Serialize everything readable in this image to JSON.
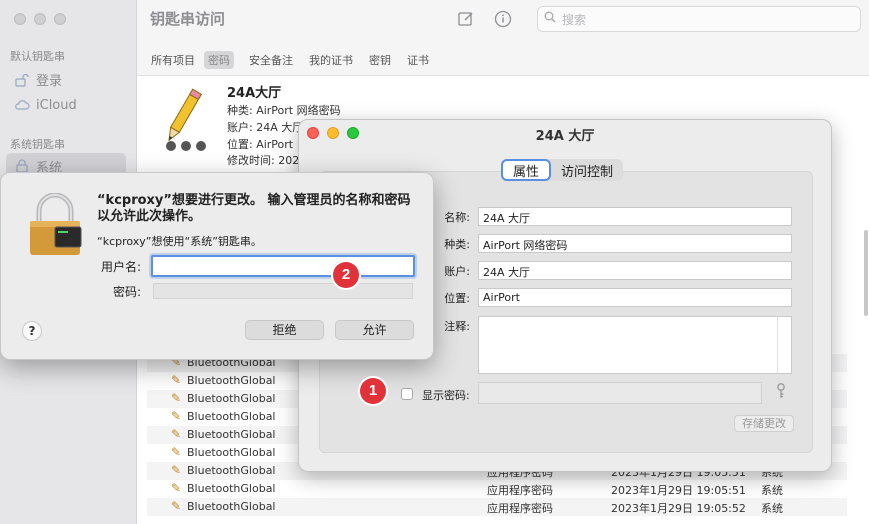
{
  "keychain": {
    "title": "钥匙串访问",
    "search_placeholder": "搜索",
    "sidebar": {
      "default_section": "默认钥匙串",
      "login": "登录",
      "icloud": "iCloud",
      "system_section": "系统钥匙串",
      "system": "系统"
    },
    "category_tabs": [
      "所有项目",
      "密码",
      "安全备注",
      "我的证书",
      "密钥",
      "证书"
    ],
    "active_tab_index": 1,
    "detail": {
      "name": "24A大厅",
      "kind": "种类:  AirPort 网络密码",
      "account": "账户:  24A 大厅",
      "where": "位置:  AirPort",
      "modified": "修改时间:  202"
    },
    "rows": [
      {
        "name": "BluetoothGlobal",
        "kind": "",
        "date": "",
        "keychain": ""
      },
      {
        "name": "BluetoothGlobal",
        "kind": "",
        "date": "",
        "keychain": ""
      },
      {
        "name": "BluetoothGlobal",
        "kind": "",
        "date": "",
        "keychain": ""
      },
      {
        "name": "BluetoothGlobal",
        "kind": "",
        "date": "",
        "keychain": ""
      },
      {
        "name": "BluetoothGlobal",
        "kind": "",
        "date": "",
        "keychain": ""
      },
      {
        "name": "BluetoothGlobal",
        "kind": "",
        "date": "",
        "keychain": ""
      },
      {
        "name": "BluetoothGlobal",
        "kind": "应用程序密码",
        "date": "2023年1月29日 19:05:51",
        "keychain": "系统"
      },
      {
        "name": "BluetoothGlobal",
        "kind": "应用程序密码",
        "date": "2023年1月29日 19:05:51",
        "keychain": "系统"
      },
      {
        "name": "BluetoothGlobal",
        "kind": "应用程序密码",
        "date": "2023年1月29日 19:05:52",
        "keychain": "系统"
      }
    ]
  },
  "attributes_window": {
    "title": "24A 大厅",
    "tabs": [
      "属性",
      "访问控制"
    ],
    "fields": {
      "name_label": "名称:",
      "name_value": "24A 大厅",
      "kind_label": "种类:",
      "kind_value": "AirPort 网络密码",
      "account_label": "账户:",
      "account_value": "24A 大厅",
      "where_label": "位置:",
      "where_value": "AirPort",
      "comments_label": "注释:",
      "show_password_label": "显示密码:"
    },
    "save_button": "存储更改"
  },
  "auth_dialog": {
    "heading": "“kcproxy”想要进行更改。 输入管理员的名称和密码以允许此次操作。",
    "subtext": "“kcproxy”想使用“系统”钥匙串。",
    "username_label": "用户名:",
    "password_label": "密码:",
    "username_value": "",
    "help_label": "?",
    "deny_button": "拒绝",
    "allow_button": "允许"
  },
  "callouts": [
    "1",
    "2"
  ]
}
